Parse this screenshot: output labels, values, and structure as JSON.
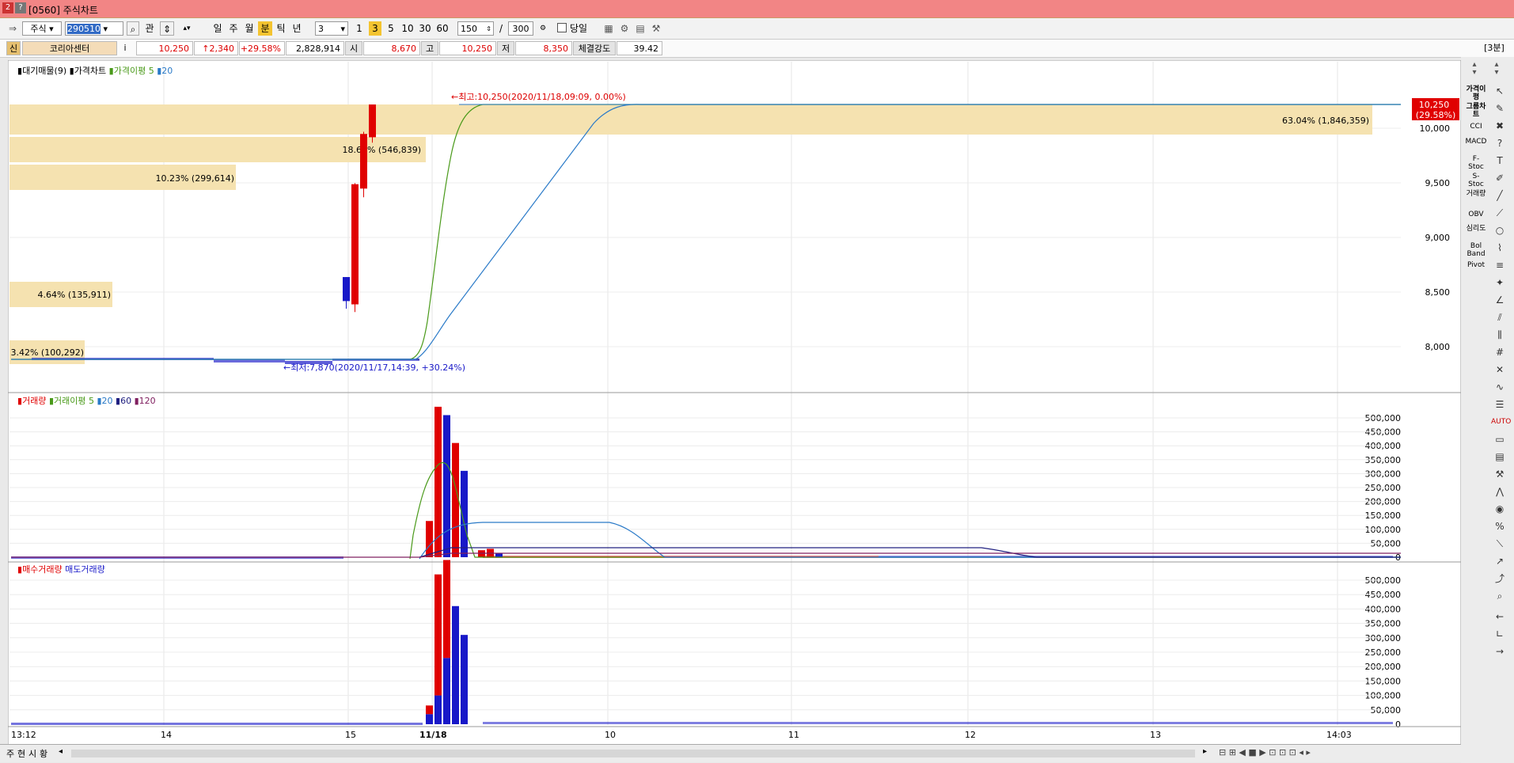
{
  "window": {
    "title": "[0560] 주식차트",
    "icon1": "2",
    "icon2": "?"
  },
  "toolbar": {
    "market": "주식",
    "code": "290510",
    "periods": [
      "일",
      "주",
      "월",
      "분",
      "틱",
      "년"
    ],
    "active_period": "분",
    "interval_value": "3",
    "quick_intervals": [
      "1",
      "3",
      "5",
      "10",
      "30",
      "60"
    ],
    "count_value": "150",
    "total_value": "300",
    "slash": "/",
    "today_label": "당일"
  },
  "info": {
    "badge": "신",
    "name": "코리아센터",
    "info_btn": "i",
    "price": "10,250",
    "change": "↑2,340",
    "rate": "+29.58%",
    "volume": "2,828,914",
    "open_label": "시",
    "open": "8,670",
    "high_label": "고",
    "high": "10,250",
    "low_label": "저",
    "low": "8,350",
    "strength_label": "체결강도",
    "strength": "39.42",
    "timeframe": "[3분]"
  },
  "panels": {
    "price": {
      "legend": [
        "대기매물(9)",
        "가격차트",
        "가격이평 5",
        "20"
      ],
      "high_annot": "←최고:10,250(2020/11/18,09:09, 0.00%)",
      "low_annot": "←최저:7,870(2020/11/17,14:39, +30.24%)",
      "current_price": "10,250",
      "current_rate": "(29.58%)",
      "y_ticks": [
        "10,000",
        "9,500",
        "9,000",
        "8,500",
        "8,000"
      ],
      "volume_profile": [
        {
          "label": "63.04% (1,846,359)"
        },
        {
          "label": "18.67% (546,839)"
        },
        {
          "label": "10.23% (299,614)"
        },
        {
          "label": "4.64% (135,911)"
        },
        {
          "label": "3.42% (100,292)"
        }
      ]
    },
    "volume": {
      "legend": [
        "거래량",
        "거래이평 5",
        "20",
        "60",
        "120"
      ],
      "y_ticks": [
        "500,000",
        "450,000",
        "400,000",
        "350,000",
        "300,000",
        "250,000",
        "200,000",
        "150,000",
        "100,000",
        "50,000",
        "0"
      ]
    },
    "buysell": {
      "legend": [
        "매수거래량",
        "매도거래량"
      ],
      "y_ticks": [
        "500,000",
        "450,000",
        "400,000",
        "350,000",
        "300,000",
        "250,000",
        "200,000",
        "150,000",
        "100,000",
        "50,000",
        "0"
      ]
    }
  },
  "x_axis": {
    "labels": [
      "13:12",
      "14",
      "15",
      "11/18",
      "10",
      "11",
      "12",
      "13",
      "14:03"
    ]
  },
  "bottom": {
    "tabs": [
      "주",
      "현",
      "시",
      "황"
    ]
  },
  "side_indicators": [
    "가격이평",
    "그룹차트",
    "CCI",
    "MACD",
    "F-Stoc",
    "S-Stoc",
    "거래량",
    "OBV",
    "심리도",
    "Bol Band",
    "Pivot"
  ],
  "colors": {
    "up": "#e00000",
    "down": "#1818c8",
    "ma5": "#4a9a1a",
    "ma20": "#2a7ac8",
    "ma60": "#202080",
    "ma120": "#802060",
    "profile": "#f5e2b0"
  },
  "chart_data": [
    {
      "type": "candlestick",
      "title": "가격차트",
      "x": [
        "11/18 09:00",
        "11/18 09:03",
        "11/18 09:06",
        "11/18 09:09"
      ],
      "open": [
        8670,
        8420,
        9480,
        9950
      ],
      "close": [
        8450,
        9520,
        9980,
        10250
      ],
      "high": [
        8670,
        9530,
        10000,
        10250
      ],
      "low": [
        8380,
        8350,
        9400,
        9900
      ],
      "ylim": [
        7700,
        10250
      ],
      "pre_market_level": 7900
    },
    {
      "type": "bar",
      "title": "거래량",
      "categories": [
        "09:00",
        "09:03",
        "09:06",
        "09:09",
        "09:12",
        "09:15",
        "09:18",
        "09:21",
        "09:24"
      ],
      "series": [
        {
          "name": "up",
          "values": [
            130000,
            540000,
            0,
            410000,
            0,
            0,
            25000,
            30000,
            0
          ]
        },
        {
          "name": "down",
          "values": [
            0,
            0,
            510000,
            0,
            310000,
            0,
            0,
            0,
            15000
          ]
        }
      ],
      "ylim": [
        0,
        520000
      ]
    },
    {
      "type": "bar",
      "title": "매수거래량 매도거래량",
      "categories": [
        "09:00",
        "09:03",
        "09:06",
        "09:09",
        "09:12"
      ],
      "series": [
        {
          "name": "매수거래량",
          "values": [
            30000,
            420000,
            340000,
            0,
            0
          ]
        },
        {
          "name": "매도거래량",
          "values": [
            35000,
            100000,
            230000,
            410000,
            310000
          ]
        }
      ],
      "ylim": [
        0,
        520000
      ]
    }
  ]
}
